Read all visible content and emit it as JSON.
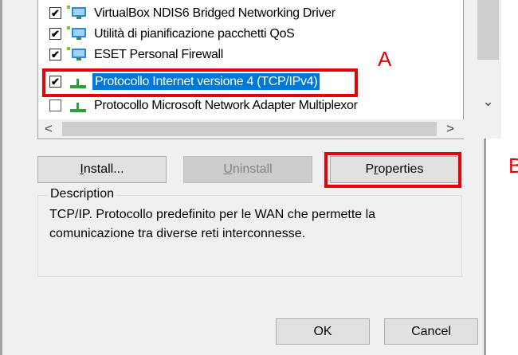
{
  "list": {
    "items": [
      {
        "label": "VirtualBox NDIS6 Bridged Networking Driver",
        "checked": true,
        "icon": "network-adapter-icon"
      },
      {
        "label": "Utilità di pianificazione pacchetti QoS",
        "checked": true,
        "icon": "network-adapter-icon"
      },
      {
        "label": "ESET Personal Firewall",
        "checked": true,
        "icon": "network-adapter-icon"
      },
      {
        "label": "Protocollo Internet versione 4 (TCP/IPv4)",
        "checked": true,
        "selected": true,
        "icon": "protocol-icon"
      },
      {
        "label": "Protocollo Microsoft Network Adapter Multiplexor",
        "checked": false,
        "icon": "protocol-icon"
      }
    ]
  },
  "scroll": {
    "down": "⌄",
    "left": "<",
    "right": ">"
  },
  "buttons": {
    "install": {
      "mnemonic": "I",
      "rest": "nstall..."
    },
    "uninstall": {
      "mnemonic": "U",
      "rest": "ninstall"
    },
    "properties": {
      "pre": "P",
      "mnemonic": "r",
      "rest": "operties"
    },
    "ok": "OK",
    "cancel": "Cancel"
  },
  "description": {
    "legend": "Description",
    "text_line1": "TCP/IP. Protocollo predefinito per le WAN che permette la",
    "text_line2": "comunicazione tra diverse reti interconnesse."
  },
  "annotations": {
    "a": "A",
    "b": "B"
  },
  "colors": {
    "highlight": "#e8000b",
    "selection": "#0078d7"
  }
}
